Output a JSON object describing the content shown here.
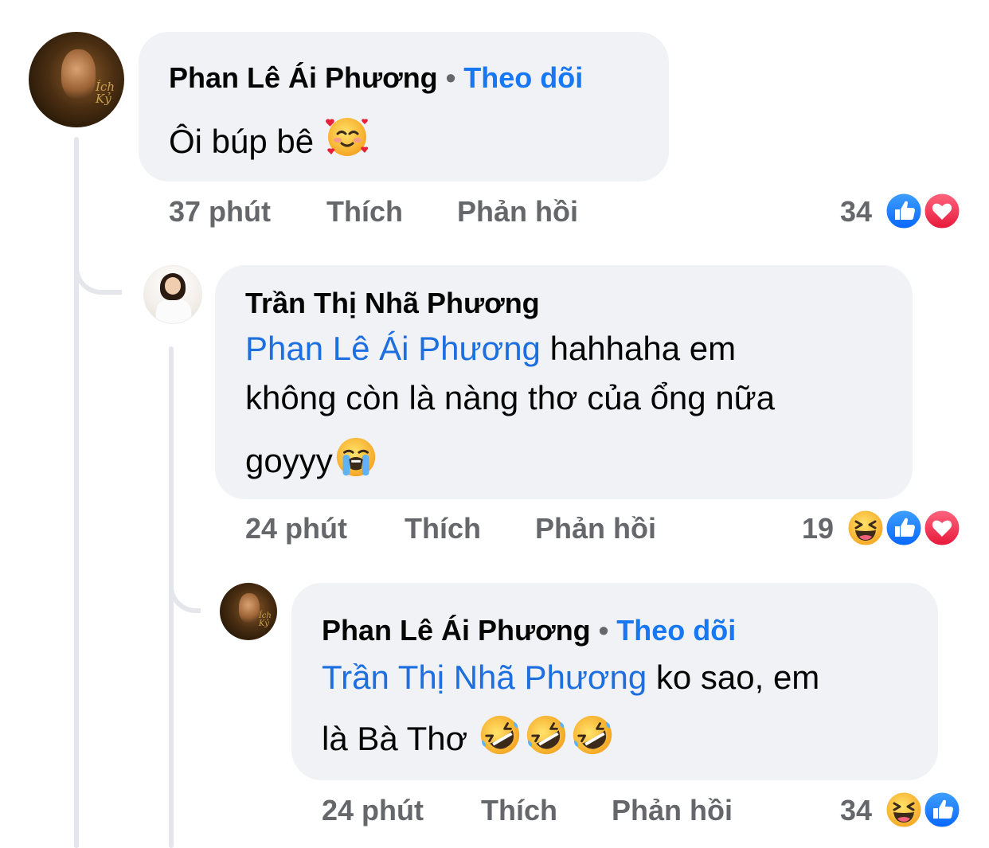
{
  "comments": [
    {
      "author": "Phan Lê Ái Phương",
      "follow_label": "Theo dõi",
      "separator": "•",
      "text": "Ôi búp bê",
      "emoji": "smiling-face-with-hearts",
      "time": "37 phút",
      "like_label": "Thích",
      "reply_label": "Phản hồi",
      "reaction_count": "34",
      "reactions": [
        "like",
        "love"
      ]
    },
    {
      "author": "Trần Thị Nhã Phương",
      "mention": "Phan Lê Ái Phương",
      "text_line1": " hahhaha em",
      "text_line2": "không còn là nàng thơ của ổng nữa",
      "text_line3": "goyyy",
      "emoji": "loudly-crying-face",
      "time": "24 phút",
      "like_label": "Thích",
      "reply_label": "Phản hồi",
      "reaction_count": "19",
      "reactions": [
        "haha",
        "like",
        "love"
      ]
    },
    {
      "author": "Phan Lê Ái Phương",
      "follow_label": "Theo dõi",
      "separator": "•",
      "mention": "Trần Thị Nhã Phương",
      "text_line1": " ko sao, em",
      "text_line2": "là Bà Thơ",
      "emoji": "rolling-on-floor-laughing x3",
      "time": "24 phút",
      "like_label": "Thích",
      "reply_label": "Phản hồi",
      "reaction_count": "34",
      "reactions": [
        "haha",
        "like"
      ]
    }
  ],
  "colors": {
    "bubble": "#f0f2f5",
    "link": "#1877f2",
    "meta": "#65676b",
    "like": "#1877f2",
    "love": "#f33e58",
    "haha": "#f7b125"
  }
}
